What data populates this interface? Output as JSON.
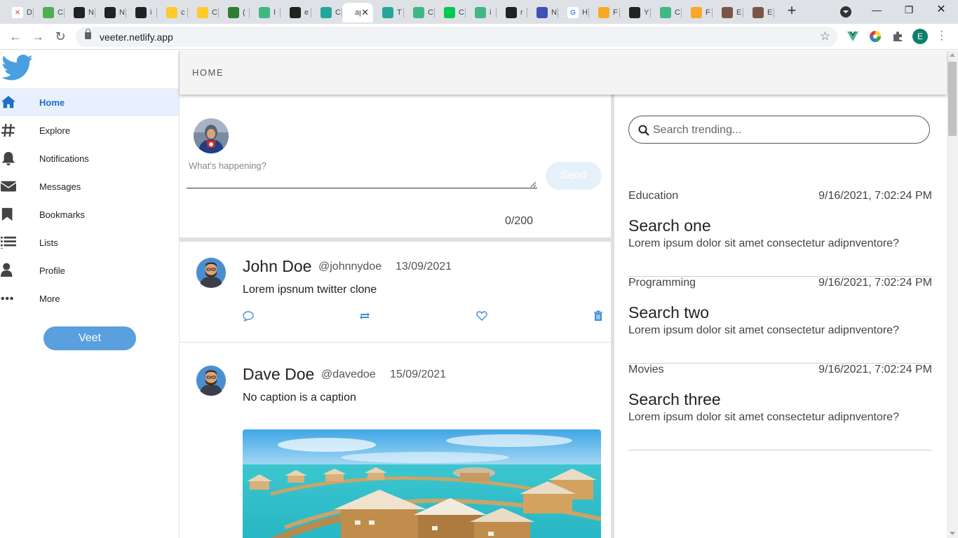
{
  "browser": {
    "tabs": [
      {
        "icon": "close-x-icon",
        "letter": "D",
        "color": "#ffffff",
        "fg": "#e53935"
      },
      {
        "icon": "nuxt-icon",
        "letter": "C",
        "color": "#4caf50",
        "fg": "#ffffff"
      },
      {
        "icon": "vercel-icon",
        "letter": "N",
        "color": "#222222",
        "fg": "#ffffff"
      },
      {
        "icon": "vercel-icon",
        "letter": "N",
        "color": "#222222",
        "fg": "#ffffff"
      },
      {
        "icon": "github-icon",
        "letter": "i",
        "color": "#222222",
        "fg": "#ffffff"
      },
      {
        "icon": "firebase-icon",
        "letter": "c",
        "color": "#ffca28",
        "fg": "#ffffff"
      },
      {
        "icon": "firebase-icon",
        "letter": "C",
        "color": "#ffca28",
        "fg": "#ffffff"
      },
      {
        "icon": "badge-icon",
        "letter": "(",
        "color": "#2e7d32",
        "fg": "#ffffff"
      },
      {
        "icon": "vue-icon",
        "letter": "I",
        "color": "#41b883",
        "fg": "#ffffff"
      },
      {
        "icon": "github-icon",
        "letter": "e",
        "color": "#222222",
        "fg": "#ffffff"
      },
      {
        "icon": "diamond-icon",
        "letter": "C",
        "color": "#26a69a",
        "fg": "#ffffff"
      },
      {
        "icon": "page-icon",
        "letter": "ap",
        "color": "#ffffff",
        "fg": "#333333"
      },
      {
        "icon": "diamond-icon",
        "letter": "T",
        "color": "#26a69a",
        "fg": "#ffffff"
      },
      {
        "icon": "vue-icon",
        "letter": "C",
        "color": "#41b883",
        "fg": "#ffffff"
      },
      {
        "icon": "green-k-icon",
        "letter": "C",
        "color": "#00c853",
        "fg": "#ffffff"
      },
      {
        "icon": "vue-icon",
        "letter": "i",
        "color": "#41b883",
        "fg": "#ffffff"
      },
      {
        "icon": "github-icon",
        "letter": "r",
        "color": "#222222",
        "fg": "#ffffff"
      },
      {
        "icon": "nojs-icon",
        "letter": "N",
        "color": "#3f51b5",
        "fg": "#ffffff"
      },
      {
        "icon": "google-icon",
        "letter": "H",
        "color": "#ffffff",
        "fg": "#4285f4"
      },
      {
        "icon": "bank-icon",
        "letter": "F",
        "color": "#f9a825",
        "fg": "#ffffff"
      },
      {
        "icon": "github-icon",
        "letter": "Y",
        "color": "#222222",
        "fg": "#ffffff"
      },
      {
        "icon": "vue-icon",
        "letter": "C",
        "color": "#41b883",
        "fg": "#ffffff"
      },
      {
        "icon": "bank-icon",
        "letter": "F",
        "color": "#f9a825",
        "fg": "#ffffff"
      },
      {
        "icon": "photo-icon",
        "letter": "E",
        "color": "#795548",
        "fg": "#ffffff"
      },
      {
        "icon": "photo-icon",
        "letter": "E",
        "color": "#795548",
        "fg": "#ffffff"
      }
    ],
    "active_tab_label": "ap",
    "url": "veeter.netlify.app",
    "profile_letter": "E"
  },
  "sidebar": {
    "items": [
      {
        "label": "Home",
        "icon": "home-icon"
      },
      {
        "label": "Explore",
        "icon": "hashtag-icon"
      },
      {
        "label": "Notifications",
        "icon": "bell-icon"
      },
      {
        "label": "Messages",
        "icon": "envelope-icon"
      },
      {
        "label": "Bookmarks",
        "icon": "bookmark-icon"
      },
      {
        "label": "Lists",
        "icon": "list-icon"
      },
      {
        "label": "Profile",
        "icon": "user-icon"
      },
      {
        "label": "More",
        "icon": "ellipsis-icon"
      }
    ],
    "active": "Home",
    "veet_label": "Veet"
  },
  "header": {
    "title": "HOME"
  },
  "compose": {
    "placeholder": "What's happening?",
    "send_label": "Send",
    "counter": "0/200"
  },
  "tweets": [
    {
      "name": "John Doe",
      "handle": "@johnnydoe",
      "date": "13/09/2021",
      "text": "Lorem ipsnum twitter clone"
    },
    {
      "name": "Dave Doe",
      "handle": "@davedoe",
      "date": "15/09/2021",
      "text": "No caption is a caption"
    }
  ],
  "trending": {
    "search_placeholder": "Search trending...",
    "items": [
      {
        "category": "Education",
        "time": "9/16/2021, 7:02:24 PM",
        "title": "Search one",
        "desc": "Lorem ipsum dolor sit amet consectetur adipnventore?"
      },
      {
        "category": "Programming",
        "time": "9/16/2021, 7:02:24 PM",
        "title": "Search two",
        "desc": "Lorem ipsum dolor sit amet consectetur adipnventore?"
      },
      {
        "category": "Movies",
        "time": "9/16/2021, 7:02:24 PM",
        "title": "Search three",
        "desc": "Lorem ipsum dolor sit amet consectetur adipnventore?"
      }
    ]
  },
  "colors": {
    "accent": "#1e6fc7",
    "veet_button": "#5a9fde",
    "active_nav_bg": "#e8f0fe",
    "action_icons": "#3d8fd9"
  }
}
